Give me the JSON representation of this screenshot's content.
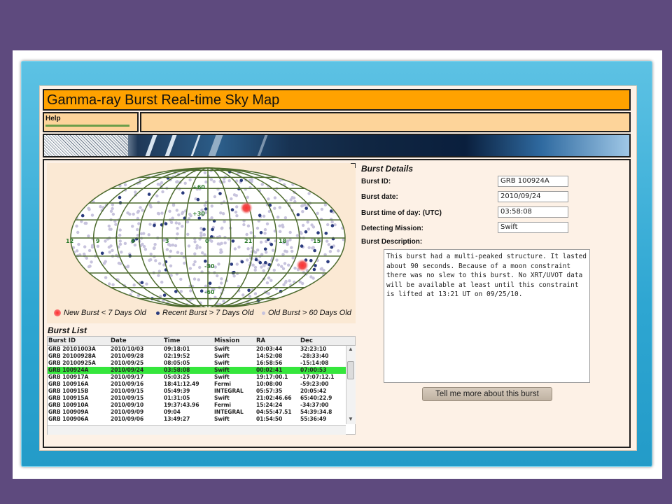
{
  "app": {
    "title": "Gamma-ray Burst Real-time Sky Map",
    "help_label": "Help"
  },
  "map": {
    "grid_labels": [
      "+60",
      "+30",
      "12",
      "9",
      "6",
      "3",
      "0",
      "21",
      "18",
      "15",
      "-30",
      "-60"
    ],
    "legend": {
      "new": "New Burst < 7 Days Old",
      "recent": "Recent Burst > 7 Days Old",
      "old": "Old Burst > 60 Days Old"
    },
    "colors": {
      "new": "#e8323a",
      "recent": "#2a3b7e",
      "old": "#c7c3dd",
      "grid": "#4d6b2e",
      "fill": "#ffffff"
    }
  },
  "details": {
    "title": "Burst Details",
    "burst_id_label": "Burst ID:",
    "burst_id": "GRB 100924A",
    "burst_date_label": "Burst date:",
    "burst_date": "2010/09/24",
    "burst_time_label": "Burst time of day: (UTC)",
    "burst_time": "03:58:08",
    "mission_label": "Detecting Mission:",
    "mission": "Swift",
    "description_label": "Burst Description:",
    "description": "This burst had a multi-peaked structure. It lasted about 90 seconds. Because of a moon constraint there was no slew to this burst. No XRT/UVOT data will be available at least until this constraint is lifted at 13:21 UT on 09/25/10.",
    "more_button": "Tell me more about this burst"
  },
  "burst_list": {
    "title": "Burst List",
    "columns": [
      "Burst ID",
      "Date",
      "Time",
      "Mission",
      "RA",
      "Dec"
    ],
    "selected_index": 3,
    "rows": [
      [
        "GRB 20101003A",
        "2010/10/03",
        "09:18:01",
        "Swift",
        "20:03:44",
        "32:23:10"
      ],
      [
        "GRB 20100928A",
        "2010/09/28",
        "02:19:52",
        "Swift",
        "14:52:08",
        "-28:33:40"
      ],
      [
        "GRB 20100925A",
        "2010/09/25",
        "08:05:05",
        "Swift",
        "16:58:56",
        "-15:14:08"
      ],
      [
        "GRB 100924A",
        "2010/09/24",
        "03:58:08",
        "Swift",
        "00:02:41",
        "07:00:53"
      ],
      [
        "GRB 100917A",
        "2010/09/17",
        "05:03:25",
        "Swift",
        "19:17:00.1",
        "-17:07:12.1"
      ],
      [
        "GRB 100916A",
        "2010/09/16",
        "18:41:12.49",
        "Fermi",
        "10:08:00",
        "-59:23:00"
      ],
      [
        "GRB 100915B",
        "2010/09/15",
        "05:49:39",
        "INTEGRAL",
        "05:57:35",
        "20:05:42"
      ],
      [
        "GRB 100915A",
        "2010/09/15",
        "01:31:05",
        "Swift",
        "21:02:46.66",
        "65:40:22.9"
      ],
      [
        "GRB 100910A",
        "2010/09/10",
        "19:37:43.96",
        "Fermi",
        "15:24:24",
        "-34:37:00"
      ],
      [
        "GRB 100909A",
        "2010/09/09",
        "09:04",
        "INTEGRAL",
        "04:55:47.51",
        "54:39:34.8"
      ],
      [
        "GRB 100906A",
        "2010/09/06",
        "13:49:27",
        "Swift",
        "01:54:50",
        "55:36:49"
      ]
    ]
  }
}
